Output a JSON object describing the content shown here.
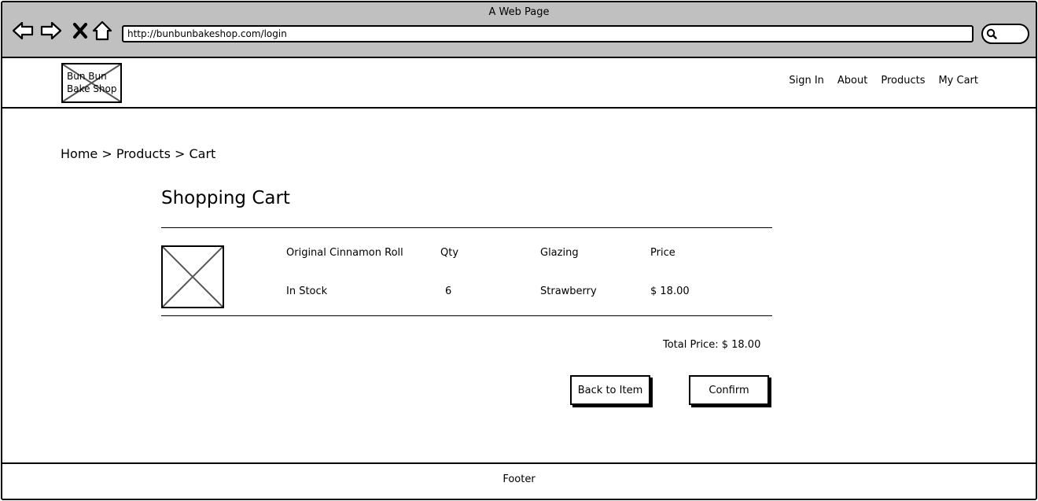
{
  "browser": {
    "window_title": "A Web Page",
    "url": "http://bunbunbakeshop.com/login"
  },
  "site": {
    "logo_text": "Bun Bun\nBake Shop",
    "nav": [
      {
        "label": "Sign In"
      },
      {
        "label": "About"
      },
      {
        "label": "Products"
      },
      {
        "label": "My Cart"
      }
    ]
  },
  "breadcrumb": {
    "text": "Home > Products > Cart"
  },
  "cart": {
    "title": "Shopping Cart",
    "item": {
      "name": "Original Cinnamon Roll",
      "stock": "In Stock",
      "qty_label": "Qty",
      "qty_value": "6",
      "glazing_label": "Glazing",
      "glazing_value": "Strawberry",
      "price_label": "Price",
      "price_value": "$ 18.00"
    },
    "total": "Total Price: $ 18.00",
    "back_button": "Back to Item",
    "confirm_button": "Confirm"
  },
  "footer": {
    "text": "Footer"
  }
}
